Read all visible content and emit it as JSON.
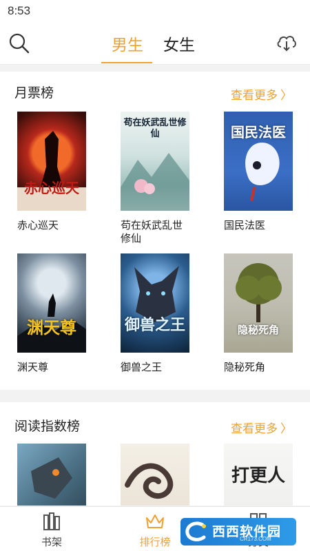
{
  "status_bar": {
    "time": "8:53"
  },
  "header": {
    "tabs": [
      {
        "label": "男生",
        "active": true
      },
      {
        "label": "女生",
        "active": false
      }
    ]
  },
  "sections": [
    {
      "title": "月票榜",
      "more": "查看更多",
      "books": [
        {
          "name": "赤心巡天",
          "cover_text": "赤心巡天"
        },
        {
          "name": "苟在妖武乱世修仙",
          "cover_text": "苟在妖武乱世修仙"
        },
        {
          "name": "国民法医",
          "cover_text": "国民法医"
        },
        {
          "name": "渊天尊",
          "cover_text": "渊天尊"
        },
        {
          "name": "御兽之王",
          "cover_text": "御兽之王"
        },
        {
          "name": "隐秘死角",
          "cover_text": "隐秘死角"
        }
      ]
    },
    {
      "title": "阅读指数榜",
      "more": "查看更多",
      "books": [
        {},
        {},
        {
          "cover_text": "打更人"
        }
      ]
    }
  ],
  "bottom_nav": [
    {
      "label": "书架",
      "icon": "bookshelf-icon",
      "active": false
    },
    {
      "label": "排行榜",
      "icon": "crown-icon",
      "active": true
    },
    {
      "label": "分类",
      "icon": "category-icon",
      "active": false
    }
  ],
  "watermark": {
    "text": "西西软件园",
    "sub": "CR173.COM"
  },
  "colors": {
    "accent": "#f0a030",
    "text": "#222222",
    "background": "#f2f2f2"
  }
}
